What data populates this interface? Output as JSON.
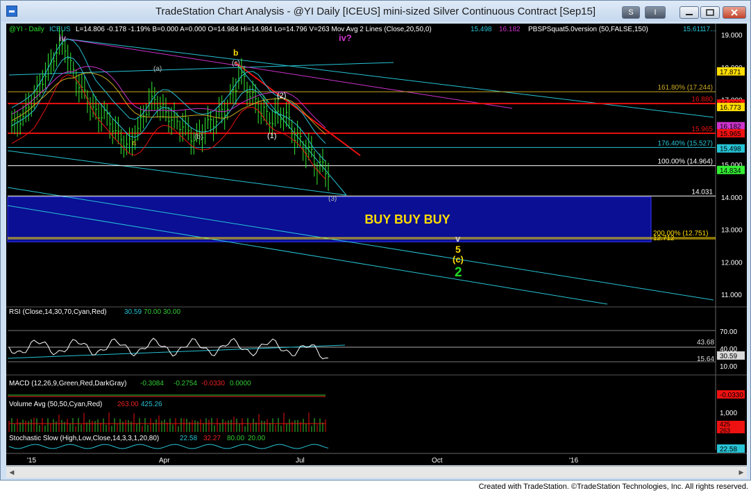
{
  "window": {
    "title": "TradeStation Chart Analysis - @YI Daily [ICEUS] mini-sized Silver Continuous Contract [Sep15]",
    "buttons": {
      "s": "S",
      "i": "I"
    },
    "credit": "Created with TradeStation. ©TradeStation Technologies, Inc. All rights reserved."
  },
  "colors": {
    "background": "#000000",
    "bar": "#33ee33",
    "buy_box": "#0a0f94",
    "buy_text": "#ffdd00",
    "cyan": "#27c4d6",
    "red": "#ee1111",
    "magenta": "#cc33cc",
    "yellow": "#ccaa22"
  },
  "header": {
    "symbol": "@YI - Daily",
    "exchange": "ICEUS",
    "quote": "L=14.806  -0.178  -1.19%  B=0.000  A=0.000  O=14.984  Hi=14.984  Lo=14.796  V=263  Mov Avg 2 Lines (Close,20,50,0)",
    "mav1": "15.498",
    "mav2": "16.182",
    "study": "PBSPSquat5.0version (50,FALSE,150)",
    "study_val": "15.611",
    "tail": "17..."
  },
  "chart_data": [
    {
      "type": "line",
      "title": "@YI Daily mini-sized Silver Continuous Contract [Sep15]",
      "ylim": [
        10.4,
        19.3
      ],
      "y_ticks": [
        "19.000",
        "18.000",
        "17.000",
        "16.000",
        "15.000",
        "14.000",
        "13.000",
        "12.000",
        "11.000"
      ],
      "x_ticks": [
        "'15",
        "Apr",
        "Jul",
        "Oct",
        "'16"
      ],
      "approx_closes": [
        16.2,
        16.4,
        16.6,
        16.9,
        17.3,
        17.6,
        17.9,
        18.3,
        18.7,
        18.6,
        18.1,
        17.6,
        17.3,
        17.1,
        16.7,
        16.5,
        16.6,
        16.3,
        16.0,
        15.8,
        15.6,
        15.7,
        16.1,
        16.5,
        16.9,
        17.0,
        16.8,
        16.6,
        16.4,
        16.3,
        16.2,
        16.0,
        15.8,
        15.9,
        16.1,
        16.3,
        16.4,
        16.6,
        16.8,
        17.2,
        17.7,
        17.6,
        17.2,
        16.9,
        16.7,
        16.5,
        16.4,
        16.5,
        16.6,
        16.3,
        15.9,
        15.7,
        15.5,
        15.3,
        15.0,
        14.9,
        14.8
      ],
      "price_labels": [
        {
          "text": "17.871",
          "value": 17.871
        },
        {
          "text": "16.880",
          "value": 16.88
        },
        {
          "text": "16.773",
          "value": 16.773
        },
        {
          "text": "16.182",
          "value": 16.182
        },
        {
          "text": "15.965",
          "value": 15.965
        },
        {
          "text": "15.498",
          "value": 15.498
        },
        {
          "text": "14.834",
          "value": 14.834
        }
      ],
      "levels": [
        {
          "text": "161.80% (17.244)",
          "value": 17.244
        },
        {
          "text": "16.880",
          "value": 16.88
        },
        {
          "text": "15.965",
          "value": 15.965
        },
        {
          "text": "176.40% (15.527)",
          "value": 15.527
        },
        {
          "text": "100.00% (14.964)",
          "value": 14.964
        },
        {
          "text": "14.031",
          "value": 14.031
        },
        {
          "text": "200.00% (12.751)",
          "value": 12.751
        },
        {
          "text": "12.712",
          "value": 12.712
        }
      ],
      "zone": {
        "label": "BUY BUY BUY",
        "from": 12.62,
        "to": 14.0
      },
      "wave_labels": [
        "iv",
        "(a)",
        "a",
        "(b)",
        "b",
        "(c)",
        "(1)",
        "(2)",
        "(3)",
        "iv?",
        "v",
        "5",
        "(c)",
        "2"
      ]
    },
    {
      "type": "line",
      "title": "RSI (Close,14,30,70,Cyan,Red)",
      "values": {
        "rsi": "30.59",
        "upper": "70.00",
        "lower": "30.00"
      },
      "y_ticks": [
        "70.00",
        "40.00",
        "10.00"
      ],
      "labels": [
        "43.68",
        "30.59",
        "15.64"
      ]
    },
    {
      "type": "line",
      "title": "MACD (12,26,9,Green,Red,DarkGray)",
      "values": {
        "macd": "-0.3084",
        "signal": "-0.2754",
        "diff": "-0.0330",
        "zero": "0.0000"
      },
      "labels": [
        "-0.0330"
      ]
    },
    {
      "type": "bar",
      "title": "Volume Avg (50,50,Cyan,Red)",
      "values": {
        "vol": "263.00",
        "avg": "425.26"
      },
      "y_ticks": [
        "1,000"
      ],
      "labels": [
        "425",
        "263"
      ]
    },
    {
      "type": "line",
      "title": "Stochastic Slow (High,Low,Close,14,3,3,1,20,80)",
      "values": {
        "k": "22.58",
        "d": "32.27",
        "upper": "80.00",
        "lower": "20.00"
      },
      "labels": [
        "22.58"
      ]
    }
  ]
}
